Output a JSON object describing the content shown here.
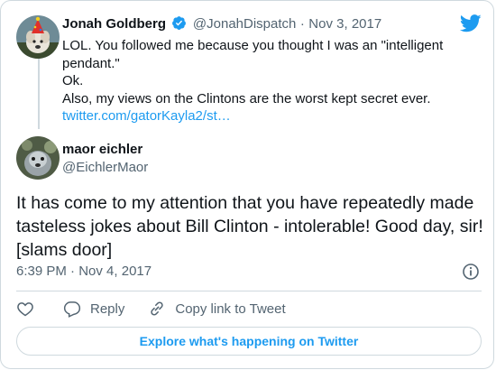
{
  "quoted_tweet": {
    "author_name": "Jonah Goldberg",
    "author_handle": "@JonahDispatch",
    "date": "Nov 3, 2017",
    "separator": "·",
    "lines": [
      "LOL. You followed me because you thought I was an \"intelligent pendant.\"",
      "Ok.",
      "Also, my views on the Clintons are the worst kept secret ever."
    ],
    "link": "twitter.com/gatorKayla2/st…"
  },
  "tweet": {
    "author_name": "maor eichler",
    "author_handle": "@EichlerMaor",
    "text": "It has come to my attention that you have repeatedly made tasteless jokes about Bill Clinton - intolerable! Good day, sir! [slams door]",
    "time": "6:39 PM",
    "separator": "·",
    "date": "Nov 4, 2017"
  },
  "actions": {
    "reply_label": "Reply",
    "copy_link_label": "Copy link to Tweet"
  },
  "explore_label": "Explore what's happening on Twitter",
  "colors": {
    "accent": "#1d9bf0",
    "verified": "#1d9bf0",
    "muted_text": "#536471",
    "border": "#cfd9de"
  },
  "icons": [
    "twitter-bird-icon",
    "verified-badge-icon",
    "info-icon",
    "heart-icon",
    "reply-icon",
    "link-icon"
  ]
}
